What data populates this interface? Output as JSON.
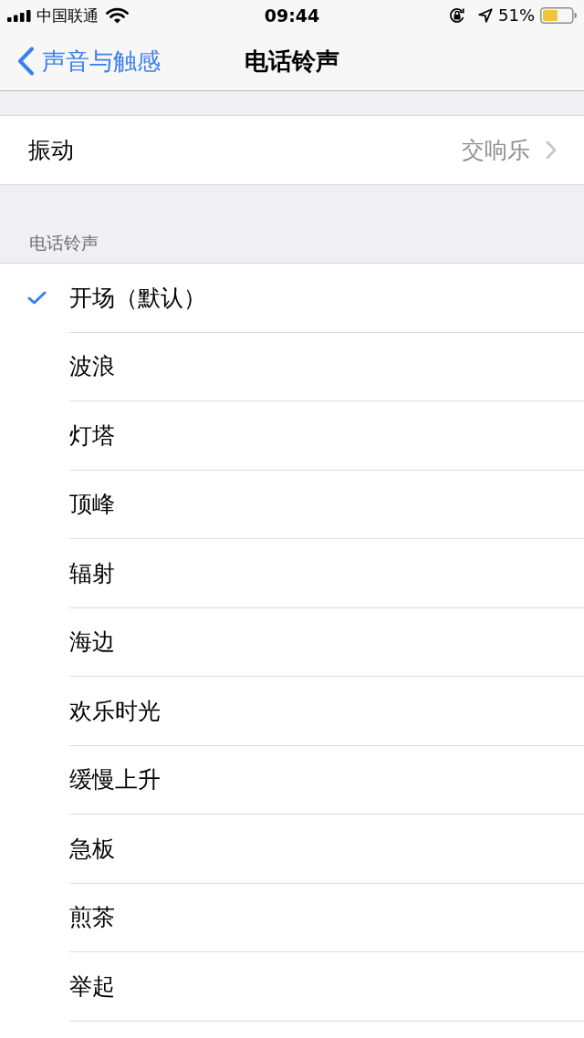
{
  "status_bar": {
    "carrier": "中国联通",
    "time": "09:44",
    "battery": "51%"
  },
  "nav_bar": {
    "back": "声音与触感",
    "title": "电话铃声"
  },
  "settings": [
    {
      "label": "振动",
      "value": "交响乐"
    }
  ],
  "ringtones": {
    "header": "电话铃声",
    "items": [
      {
        "label": "开场（默认）",
        "selected": true
      },
      {
        "label": "波浪",
        "selected": false
      },
      {
        "label": "灯塔",
        "selected": false
      },
      {
        "label": "顶峰",
        "selected": false
      },
      {
        "label": "辐射",
        "selected": false
      },
      {
        "label": "海边",
        "selected": false
      },
      {
        "label": "欢乐时光",
        "selected": false
      },
      {
        "label": "缓慢上升",
        "selected": false
      },
      {
        "label": "急板",
        "selected": false
      },
      {
        "label": "煎茶",
        "selected": false
      },
      {
        "label": "举起",
        "selected": false
      }
    ]
  }
}
